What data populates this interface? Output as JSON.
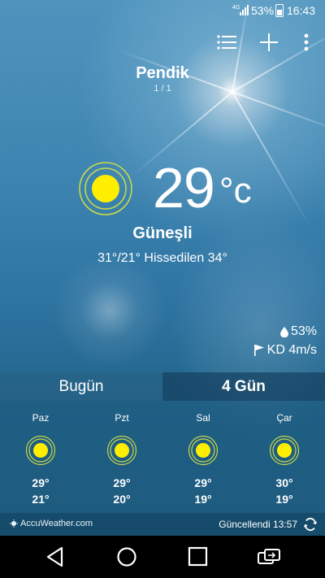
{
  "status_bar": {
    "network": "4G",
    "battery_percent": "53%",
    "time": "16:43"
  },
  "location": {
    "name": "Pendik",
    "page": "1 / 1"
  },
  "current": {
    "temperature": "29",
    "unit": "°c",
    "condition": "Güneşli",
    "hi_lo_feels": "31°/21° Hissedilen 34°",
    "humidity": "53%",
    "wind": "KD 4m/s",
    "icon": "sun-icon"
  },
  "tabs": [
    {
      "label": "Bugün",
      "selected": false
    },
    {
      "label": "4 Gün",
      "selected": true
    }
  ],
  "forecast": [
    {
      "day": "Paz",
      "high": "29°",
      "low": "21°",
      "icon": "sun-icon"
    },
    {
      "day": "Pzt",
      "high": "29°",
      "low": "20°",
      "icon": "sun-icon"
    },
    {
      "day": "Sal",
      "high": "29°",
      "low": "19°",
      "icon": "sun-icon"
    },
    {
      "day": "Çar",
      "high": "30°",
      "low": "19°",
      "icon": "sun-icon"
    }
  ],
  "footer": {
    "provider": "AccuWeather.com",
    "updated": "Güncellendi 13:57"
  },
  "colors": {
    "sun_yellow": "#ffee00",
    "sun_ring": "#c8d84a"
  }
}
